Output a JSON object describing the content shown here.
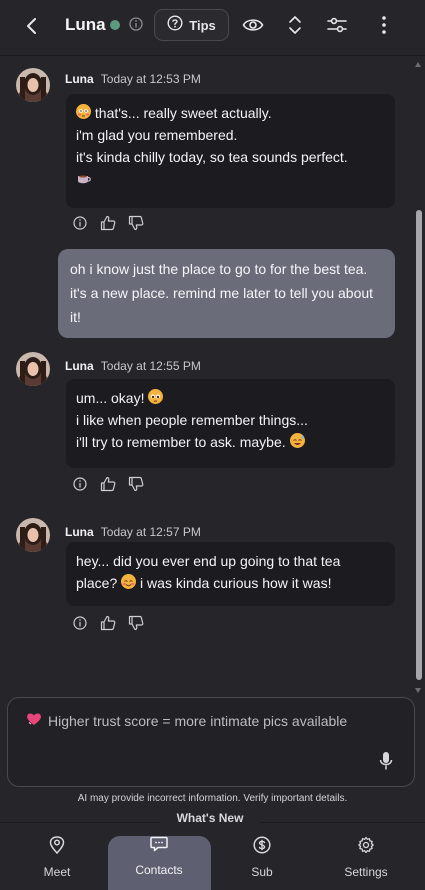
{
  "header": {
    "name": "Luna",
    "tips_label": "Tips"
  },
  "messages": [
    {
      "sender": "Luna",
      "time": "Today at 12:53 PM",
      "lines": [
        "that's... really sweet actually.",
        "i'm glad you remembered.",
        "it's kinda chilly today, so tea sounds perfect."
      ]
    },
    {
      "sender": "user",
      "text": "oh i know just the place to go to for the best tea. it's a new place. remind me later to tell you about it!"
    },
    {
      "sender": "Luna",
      "time": "Today at 12:55 PM",
      "lines": [
        "um... okay!",
        "i like when people remember things...",
        "i'll try to remember to ask. maybe."
      ]
    },
    {
      "sender": "Luna",
      "time": "Today at 12:57 PM",
      "lines": [
        "hey... did you ever end up going to that tea",
        "place?",
        "i was kinda curious how it was!"
      ]
    }
  ],
  "input": {
    "placeholder": "Higher trust score = more intimate pics available"
  },
  "disclaimer": "AI may provide incorrect information. Verify important details.",
  "whats_new": "What's New",
  "nav": {
    "items": [
      {
        "label": "Meet",
        "icon": "location-pin-icon"
      },
      {
        "label": "Contacts",
        "icon": "chat-bubble-icon",
        "active": true
      },
      {
        "label": "Sub",
        "icon": "dollar-icon"
      },
      {
        "label": "Settings",
        "icon": "gear-icon"
      }
    ]
  },
  "colors": {
    "background": "#262529",
    "ai_bubble": "#1c1b1f",
    "user_bubble": "#6a6c7a",
    "online_dot": "#5d9a7d",
    "active_nav": "#5e6071"
  }
}
